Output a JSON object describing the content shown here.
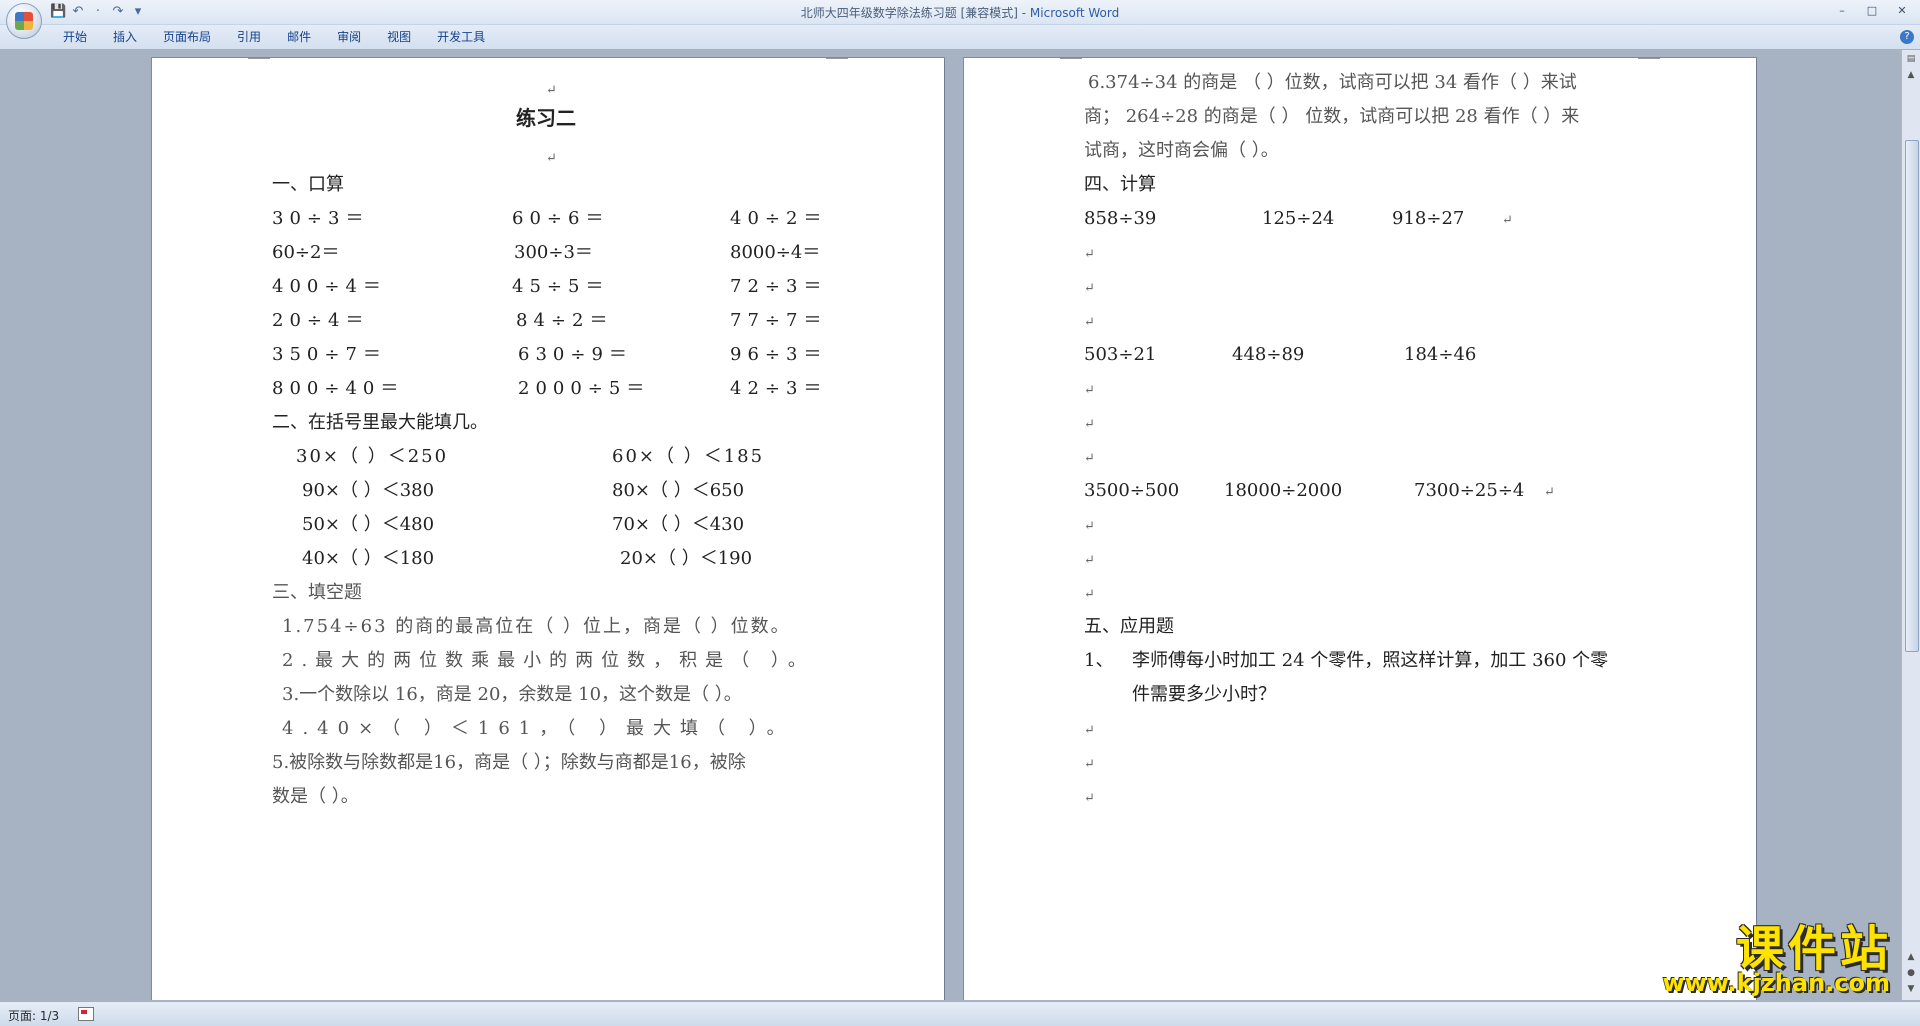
{
  "window": {
    "title": "北师大四年级数学除法练习题 [兼容模式] - ",
    "app_name": "Microsoft Word",
    "controls": [
      "–",
      "□",
      "✕"
    ]
  },
  "quick_access": [
    {
      "icon": "save-icon",
      "glyph": "💾"
    },
    {
      "icon": "undo-icon",
      "glyph": "↶"
    },
    {
      "icon": "dropdown-icon",
      "glyph": "·"
    },
    {
      "icon": "redo-icon",
      "glyph": "↷"
    },
    {
      "icon": "customize-icon",
      "glyph": "▾"
    }
  ],
  "tabs": [
    "开始",
    "插入",
    "页面布局",
    "引用",
    "邮件",
    "审阅",
    "视图",
    "开发工具"
  ],
  "help_glyph": "?",
  "status": {
    "page": "页面: 1/3"
  },
  "watermark": {
    "text": "课件站",
    "url": "www.kjzhan.com"
  },
  "page1": {
    "mark": "↵",
    "title": "练习二",
    "s1_heading": "一、口算",
    "s1_rows": [
      [
        "30÷3＝",
        "60÷6＝",
        "40÷2＝"
      ],
      [
        "60÷2＝",
        "300÷3＝",
        "8000÷4＝"
      ],
      [
        "400÷4＝",
        "45÷5＝",
        "72÷3＝"
      ],
      [
        "20÷4＝",
        "84÷2＝",
        "77÷7＝"
      ],
      [
        "350÷7＝",
        "630÷9＝",
        "96÷3＝"
      ],
      [
        "800÷40＝",
        "2000÷5＝",
        "42÷3＝"
      ]
    ],
    "s2_heading": "二、在括号里最大能填几。",
    "s2_rows": [
      [
        "30×（        ）＜250",
        "60×（        ）＜185"
      ],
      [
        "90×（      ）＜380",
        "80×（      ）＜650"
      ],
      [
        "50×（      ）＜480",
        "70×（      ）＜430"
      ],
      [
        "40×（      ）＜180",
        "20×（      ）＜190"
      ]
    ],
    "s3_heading": "三、填空题",
    "s3_lines": [
      "1.754÷63 的商的最高位在（  ）位上，商是（  ）位数。",
      "2.最大的两位数乘最小的两位数，积是（  ）。",
      "3.一个数除以 16，商是 20，余数是 10，这个数是（  ）。",
      "4.40×（   ）＜161，（   ）最大填（   ）。",
      "5.被除数与除数都是16，商是（  ）；除数与商都是16，被除",
      "数是（  ）。"
    ]
  },
  "page2": {
    "mark": "↵",
    "cont_lines": [
      "6.374÷34 的商是 （   ）位数，试商可以把 34 看作（   ）来试",
      "商； 264÷28 的商是（   ） 位数，试商可以把 28 看作（   ）来",
      "试商，这时商会偏（  ）。"
    ],
    "s4_heading": "四、计算",
    "s4_rows": [
      [
        "858÷39",
        "125÷24",
        "918÷27"
      ],
      [
        "503÷21",
        "448÷89",
        "184÷46"
      ],
      [
        "3500÷500",
        "18000÷2000",
        "7300÷25÷4"
      ]
    ],
    "s5_heading": "五、应用题",
    "s5_q1_num": "1、",
    "s5_q1_line1": "李师傅每小时加工 24 个零件，照这样计算，加工 360 个零",
    "s5_q1_line2": "件需要多少小时？"
  }
}
